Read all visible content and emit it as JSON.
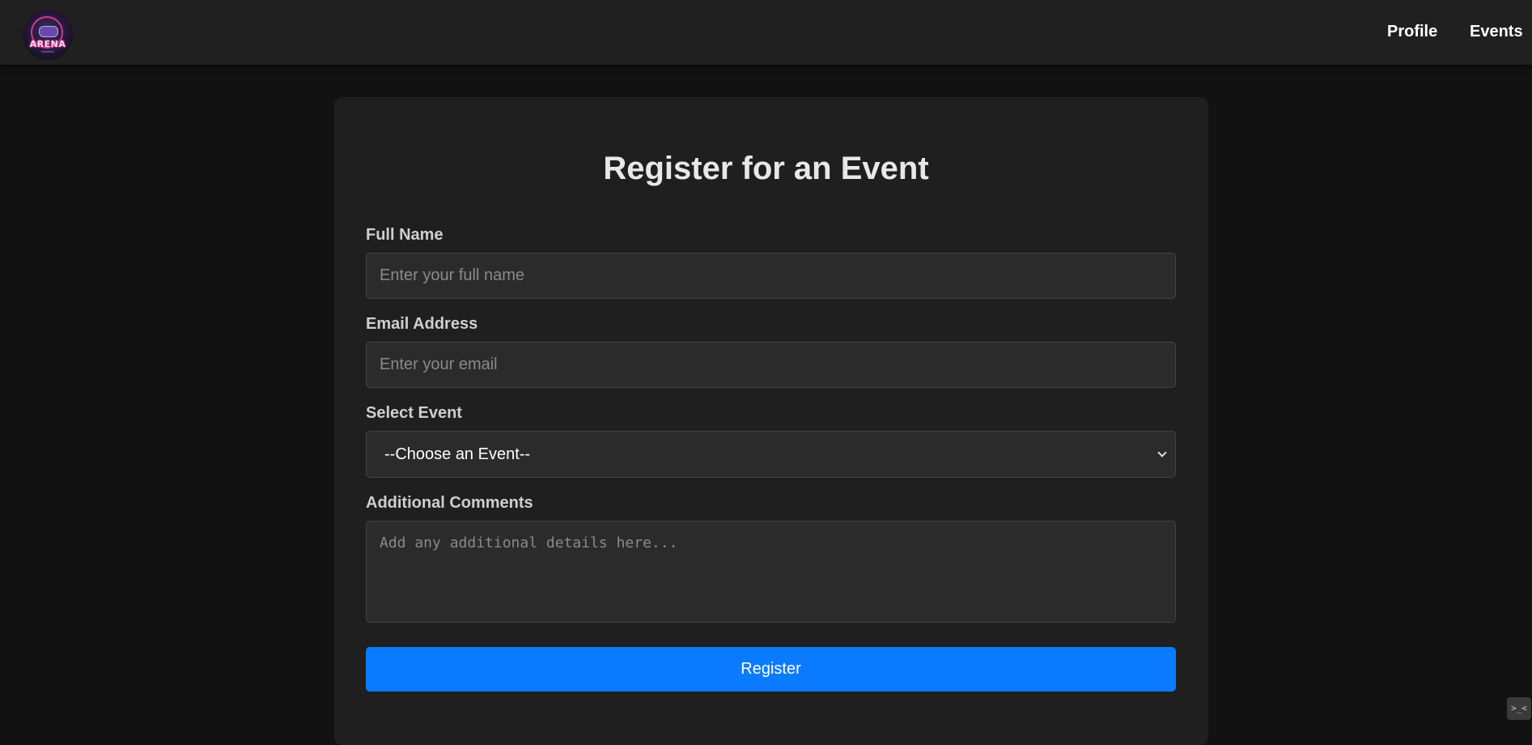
{
  "nav": {
    "logo_text": "ARENA",
    "logo_subtext": "GAMING",
    "links": [
      {
        "label": "Profile"
      },
      {
        "label": "Events"
      }
    ]
  },
  "form": {
    "title": "Register for an Event",
    "full_name": {
      "label": "Full Name",
      "placeholder": "Enter your full name",
      "value": ""
    },
    "email": {
      "label": "Email Address",
      "placeholder": "Enter your email",
      "value": ""
    },
    "event": {
      "label": "Select Event",
      "selected": "--Choose an Event--"
    },
    "comments": {
      "label": "Additional Comments",
      "placeholder": "Add any additional details here...",
      "value": ""
    },
    "submit_label": "Register"
  },
  "widget": {
    "icon": ">_<"
  },
  "colors": {
    "background": "#121212",
    "navbar": "#202020",
    "card": "#1f1f1f",
    "field": "#2b2b2b",
    "primary_button": "#0a7bff"
  },
  "icons": {
    "select_arrow": "chevron-down-icon",
    "logo": "arena-logo-icon"
  }
}
